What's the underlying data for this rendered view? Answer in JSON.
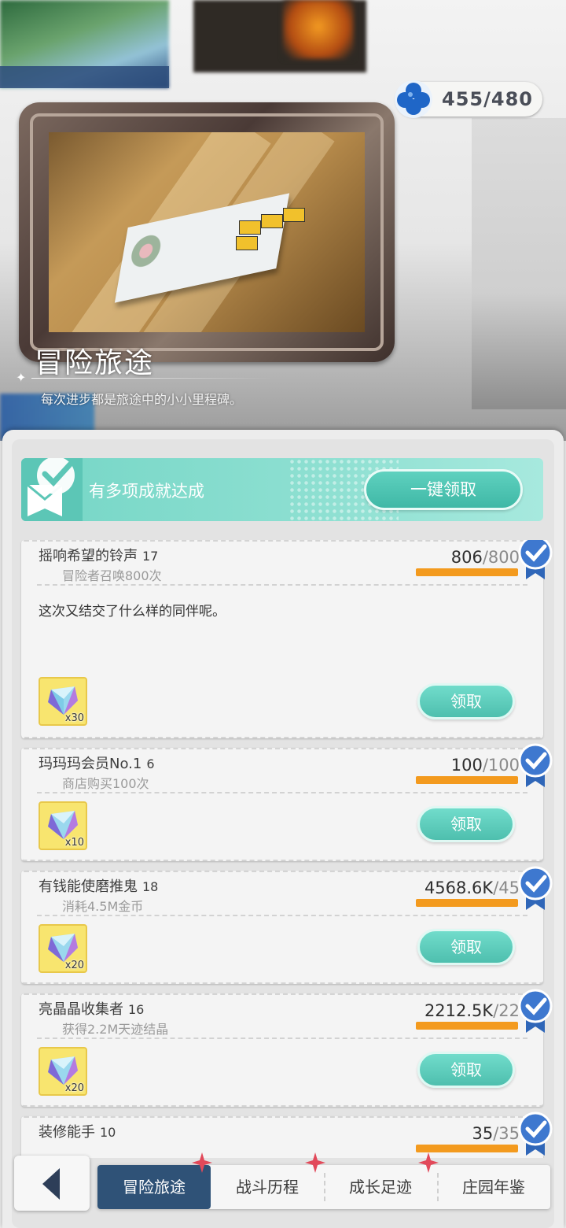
{
  "currency": {
    "value": "455/480",
    "icon": "clover-icon",
    "color": "#1f66c7"
  },
  "header": {
    "title": "冒险旅途",
    "subtitle": "每次进步都是旅途中的小小里程碑。"
  },
  "banner": {
    "text": "有多项成就达成",
    "claim_all_label": "一键领取"
  },
  "achievements": [
    {
      "name": "摇响希望的铃声",
      "level": "17",
      "desc": "冒险者召唤800次",
      "current": "806",
      "total": "/800",
      "progress": 1.0,
      "flavor": "这次又结交了什么样的同伴呢。",
      "reward_icon": "gem-icon",
      "reward_count": "x30",
      "claim_label": "领取",
      "completed": true
    },
    {
      "name": "玛玛玛会员No.1",
      "level": "6",
      "desc": "商店购买100次",
      "current": "100",
      "total": "/100",
      "progress": 1.0,
      "reward_icon": "gem-icon",
      "reward_count": "x10",
      "claim_label": "领取",
      "completed": true
    },
    {
      "name": "有钱能使磨推鬼",
      "level": "18",
      "desc": "消耗4.5M金币",
      "current": "4568.6K",
      "total": "/45",
      "progress": 1.0,
      "reward_icon": "gem-icon",
      "reward_count": "x20",
      "claim_label": "领取",
      "completed": true
    },
    {
      "name": "亮晶晶收集者",
      "level": "16",
      "desc": "获得2.2M天迹结晶",
      "current": "2212.5K",
      "total": "/22",
      "progress": 1.0,
      "reward_icon": "gem-icon",
      "reward_count": "x20",
      "claim_label": "领取",
      "completed": true
    },
    {
      "name": "装修能手",
      "level": "10",
      "current": "35",
      "total": "/35",
      "progress": 1.0,
      "completed": true
    }
  ],
  "nav": {
    "back_icon": "back-arrow-icon",
    "tabs": [
      {
        "label": "冒险旅途",
        "active": true,
        "badge": true
      },
      {
        "label": "战斗历程",
        "active": false,
        "badge": true
      },
      {
        "label": "成长足迹",
        "active": false,
        "badge": true
      },
      {
        "label": "庄园年鉴",
        "active": false,
        "badge": false
      }
    ]
  },
  "colors": {
    "accent": "#4ebfae",
    "progress": "#f39a1e",
    "nav_active": "#2f5277",
    "badge": "#e2495a"
  }
}
